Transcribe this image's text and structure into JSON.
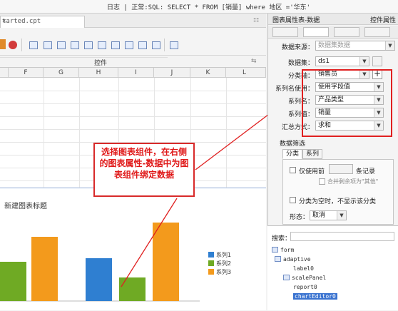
{
  "titlebar": {
    "text": "日志 | 正常:SQL: SELECT * FROM [销量] where 地区 ='华东'"
  },
  "doc_tab": {
    "label": "tarted.cpt",
    "close": "×"
  },
  "toolbar": {
    "group_label": "控件",
    "expand": "⇆"
  },
  "sheet": {
    "columns": [
      "F",
      "G",
      "H",
      "I",
      "J",
      "K",
      "L"
    ]
  },
  "chart": {
    "title": "新建图表标题",
    "legend": [
      "系列1",
      "系列2",
      "系列3"
    ],
    "colors": [
      "#2f7fd1",
      "#6faa24",
      "#f39a1c"
    ]
  },
  "chart_data": {
    "type": "bar",
    "title": "新建图表标题",
    "series": [
      {
        "name": "系列1",
        "values": [
          null,
          60,
          null
        ]
      },
      {
        "name": "系列2",
        "values": [
          55,
          33,
          null
        ]
      },
      {
        "name": "系列3",
        "values": [
          90,
          null,
          110
        ]
      }
    ],
    "categories": [
      "",
      "",
      ""
    ],
    "legend_position": "right"
  },
  "callout": {
    "text": "选择图表组件，在右侧的图表属性-数据中为图表组件绑定数据"
  },
  "right_panel": {
    "title": "图表属性表-数据",
    "widget_props": "控件属性",
    "source_label": "数据来源：",
    "source_value": "数据集数据",
    "dataset_label": "数据集：",
    "dataset_value": "ds1",
    "category_label": "分类轴：",
    "category_value": "销售员",
    "series_name_use_label": "系列名使用：",
    "series_name_use_value": "使用字段值",
    "series_name_label": "系列名：",
    "series_name_value": "产品类型",
    "series_value_label": "系列值：",
    "series_value_value": "销量",
    "summary_label": "汇总方式：",
    "summary_value": "求和",
    "filter_title": "数据筛选",
    "filter_tabs": [
      "分类",
      "系列"
    ],
    "only_use_prefix": "仅使用前",
    "only_use_suffix": "条记录",
    "merge_rest": "合并剩余项为\"其他\"",
    "null_hide": "分类为空时，不显示该分类",
    "shape_label": "形态：",
    "shape_value": "取消"
  },
  "tree": {
    "search_label": "搜索：",
    "items": [
      "form",
      "adaptive",
      "label0",
      "scalePanel",
      "report0",
      "chartEditor0"
    ]
  }
}
